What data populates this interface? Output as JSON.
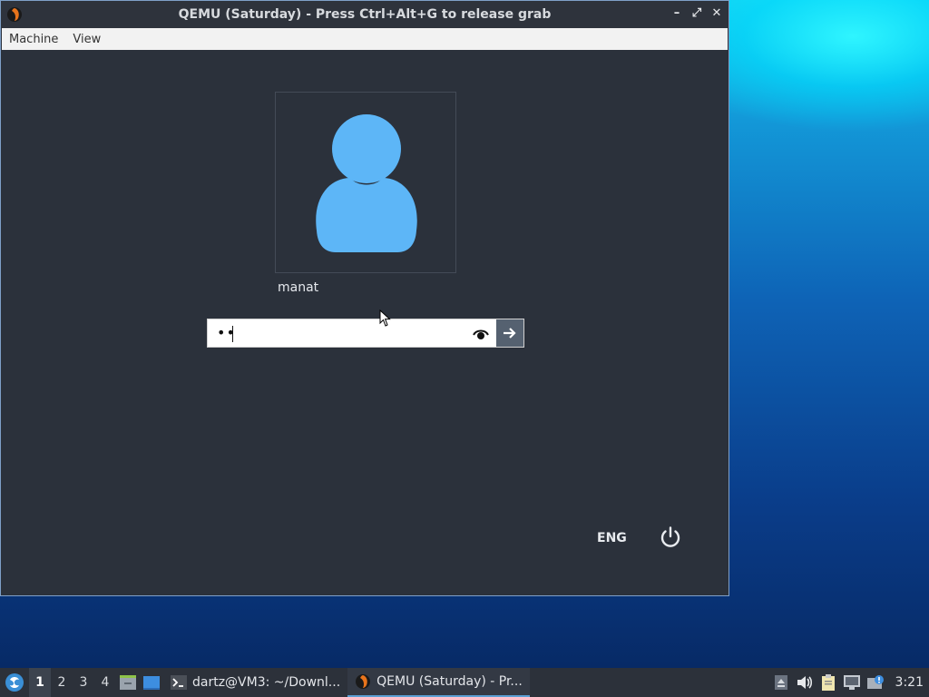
{
  "window": {
    "title": "QEMU (Saturday) - Press Ctrl+Alt+G to release grab",
    "controls": {
      "minimize": "–",
      "maximize": "⤢",
      "close": "✕"
    }
  },
  "menubar": {
    "items": [
      "Machine",
      "View"
    ]
  },
  "login": {
    "username": "manat",
    "password_masked": "••",
    "reveal_icon": "eye-icon",
    "submit_icon": "arrow-right-icon"
  },
  "bottom": {
    "language": "ENG",
    "power_icon": "power-icon"
  },
  "taskbar": {
    "workspaces": [
      "1",
      "2",
      "3",
      "4"
    ],
    "active_workspace": "1",
    "tasks": [
      {
        "label": "dartz@VM3: ~/Downl...",
        "icon": "terminal-icon"
      },
      {
        "label": "QEMU (Saturday) - Pr...",
        "icon": "qemu-icon",
        "active": true
      }
    ],
    "clock": "3:21"
  },
  "colors": {
    "vm_background": "#2b313b",
    "avatar": "#5db6f7",
    "submit_button": "#556170",
    "taskbar": "#2c313a"
  }
}
